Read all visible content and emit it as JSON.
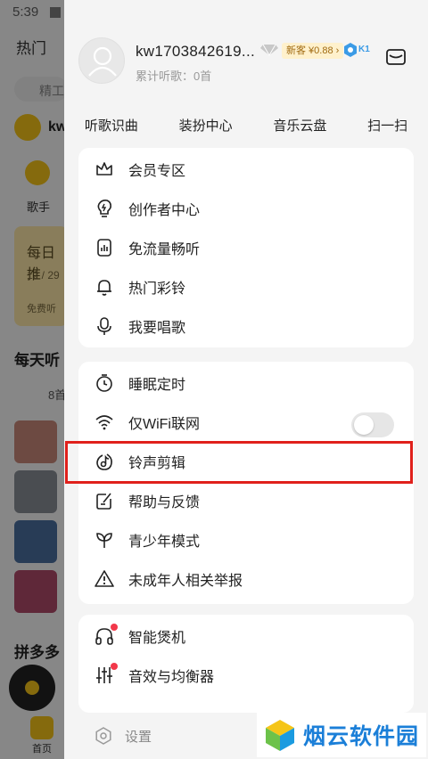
{
  "status_bar": {
    "time": "5:39"
  },
  "background_app": {
    "tab_label": "热门",
    "search_hint": "精工",
    "user_short": "kw",
    "singer_label": "歌手",
    "daily_title": "每日推",
    "daily_date": "12 / 29",
    "daily_sub": "免费听",
    "section_title": "每天听",
    "playlist_count": "8首",
    "section2_title": "拼多多",
    "home_label": "首页"
  },
  "profile": {
    "username": "kw1703842619...",
    "listen_count": "累计听歌：0首",
    "newbie_badge": "新客 ¥0.88 ›",
    "level": "K1"
  },
  "quick_actions": [
    {
      "label": "听歌识曲"
    },
    {
      "label": "装扮中心"
    },
    {
      "label": "音乐云盘"
    },
    {
      "label": "扫一扫"
    }
  ],
  "card1": [
    {
      "label": "会员专区",
      "icon": "crown-icon"
    },
    {
      "label": "创作者中心",
      "icon": "bulb-icon"
    },
    {
      "label": "免流量畅听",
      "icon": "chart-phone-icon"
    },
    {
      "label": "热门彩铃",
      "icon": "bell-icon"
    },
    {
      "label": "我要唱歌",
      "icon": "microphone-icon"
    }
  ],
  "card2": [
    {
      "label": "睡眠定时",
      "icon": "timer-icon"
    },
    {
      "label": "仅WiFi联网",
      "icon": "wifi-icon",
      "toggle": false
    },
    {
      "label": "铃声剪辑",
      "icon": "ringtone-icon"
    },
    {
      "label": "帮助与反馈",
      "icon": "feedback-icon"
    },
    {
      "label": "青少年模式",
      "icon": "sprout-icon"
    },
    {
      "label": "未成年人相关举报",
      "icon": "warning-icon"
    }
  ],
  "card3": [
    {
      "label": "智能煲机",
      "icon": "headphones-icon",
      "dot": true
    },
    {
      "label": "音效与均衡器",
      "icon": "equalizer-icon",
      "dot": true
    }
  ],
  "settings": {
    "label": "设置"
  },
  "watermark": {
    "text": "烟云软件园"
  },
  "colors": {
    "highlight": "#e0201b",
    "accent": "#1b7fd8",
    "reddot": "#f2384a"
  }
}
